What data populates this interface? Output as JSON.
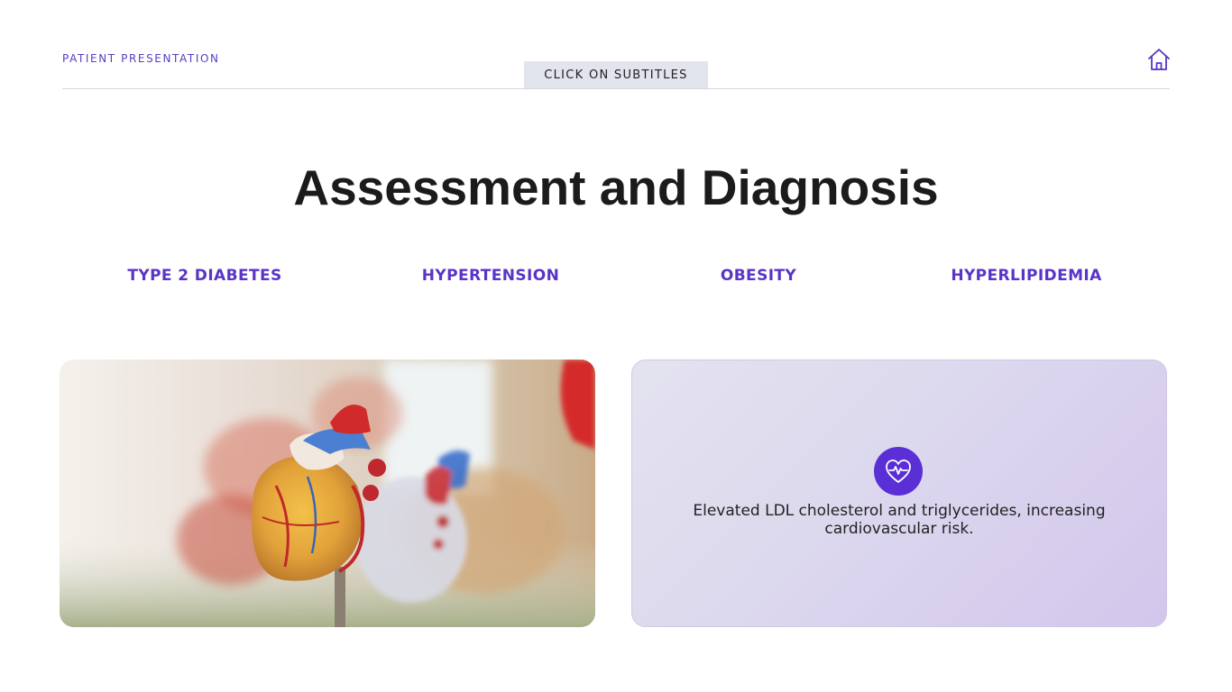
{
  "header": {
    "section_label": "PATIENT PRESENTATION",
    "subtitles_button": "CLICK ON SUBTITLES",
    "home_icon": "home-icon"
  },
  "main": {
    "title": "Assessment and Diagnosis",
    "tabs": [
      {
        "label": "TYPE 2 DIABETES"
      },
      {
        "label": "HYPERTENSION"
      },
      {
        "label": "OBESITY"
      },
      {
        "label": "HYPERLIPIDEMIA"
      }
    ],
    "photo": {
      "icon": "anatomical-heart-model-photo"
    },
    "info_card": {
      "icon": "heartbeat-icon",
      "text": "Elevated LDL cholesterol and triglycerides, increasing cardiovascular risk."
    }
  },
  "colors": {
    "accent": "#5a34c6",
    "icon_circle": "#5a2fd6",
    "subtitle_bg": "#e2e4ee"
  }
}
